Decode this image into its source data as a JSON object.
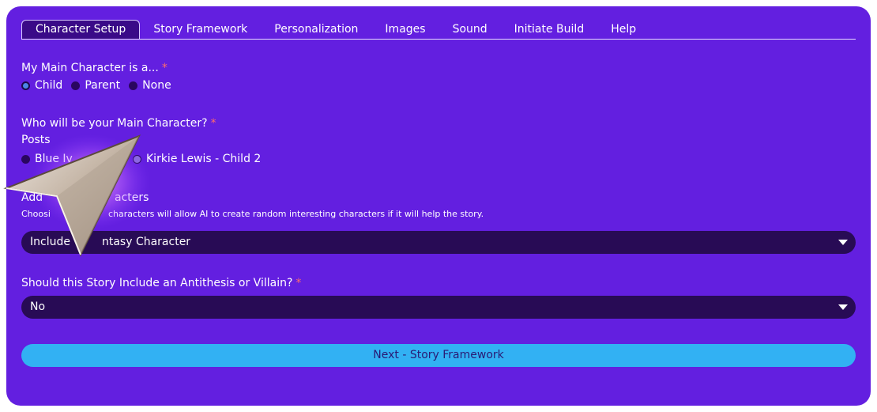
{
  "tabs": [
    {
      "label": "Character Setup",
      "active": true
    },
    {
      "label": "Story Framework",
      "active": false
    },
    {
      "label": "Personalization",
      "active": false
    },
    {
      "label": "Images",
      "active": false
    },
    {
      "label": "Sound",
      "active": false
    },
    {
      "label": "Initiate Build",
      "active": false
    },
    {
      "label": "Help",
      "active": false
    }
  ],
  "main_character_type": {
    "label": "My Main Character is a...",
    "required_mark": "*",
    "options": [
      "Child",
      "Parent",
      "None"
    ],
    "selected": "Child"
  },
  "who_main_character": {
    "label": "Who will be your Main Character?",
    "required_mark": "*",
    "group_label": "Posts",
    "options": [
      "Blue Ivy",
      "Kirkie Lewis - Child 2"
    ],
    "visible_fragments": [
      "Blue Iv",
      "Kirkie Lewis - Child 2"
    ]
  },
  "additional_characters": {
    "label_fragment": "Add... characters",
    "label_visible_left": "Add",
    "label_visible_right": "acters",
    "help_visible_left": "Choosi",
    "help_visible_right": "characters will allow AI to create random interesting characters if it will help the story.",
    "select_visible_left": "Include",
    "select_visible_right": "ntasy Character"
  },
  "villain": {
    "label": "Should this Story Include an Antithesis or Villain?",
    "required_mark": "*",
    "selected_value": "No"
  },
  "next_button": {
    "label": "Next - Story Framework"
  },
  "colors": {
    "background": "#631fe0",
    "tab_active_bg": "#3a0a88",
    "select_bg": "#280b55",
    "button_bg": "#32b1f3",
    "required": "#ff6b6b"
  },
  "overlay": {
    "icon": "mouse-pointer-arrow-icon"
  }
}
